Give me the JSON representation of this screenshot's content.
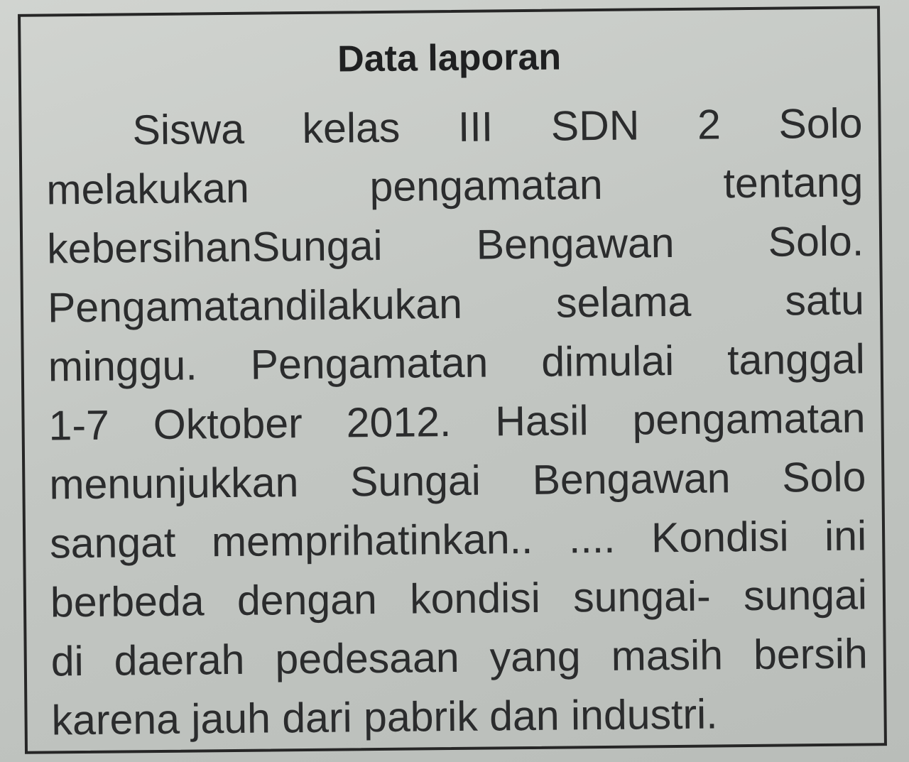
{
  "report": {
    "title": "Data laporan",
    "lines": [
      "Siswa kelas III SDN 2 Solo",
      "melakukan pengamatan tentang",
      "kebersihanSungai Bengawan Solo.",
      "Pengamatandilakukan selama satu",
      "minggu. Pengamatan dimulai tanggal",
      "1-7 Oktober 2012. Hasil pengamatan",
      "menunjukkan Sungai Bengawan Solo",
      "sangat memprihatinkan.. .... Kondisi ini",
      "berbeda dengan kondisi sungai- sungai",
      "di daerah pedesaan yang masih bersih",
      "karena jauh dari pabrik dan industri."
    ]
  }
}
